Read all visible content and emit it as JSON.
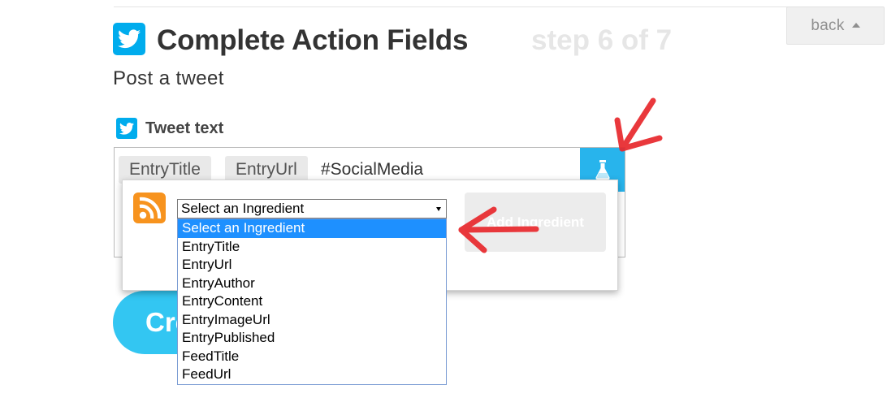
{
  "header": {
    "title": "Complete Action Fields",
    "step": "step 6 of 7",
    "subtitle": "Post a tweet",
    "back_label": "back"
  },
  "field": {
    "label": "Tweet text",
    "tokens": [
      "EntryTitle",
      "EntryUrl"
    ],
    "text": "#SocialMedia"
  },
  "ingredient_picker": {
    "selected": "Select an Ingredient",
    "options": [
      "Select an Ingredient",
      "EntryTitle",
      "EntryUrl",
      "EntryAuthor",
      "EntryContent",
      "EntryImageUrl",
      "EntryPublished",
      "FeedTitle",
      "FeedUrl"
    ],
    "add_label": "Add Ingredient"
  },
  "create_button_label": "Create Action",
  "icons": {
    "service": "twitter-bird-icon",
    "trigger": "rss-feed-icon",
    "ingredients": "flask-icon"
  },
  "colors": {
    "twitter_blue": "#00aced",
    "flask_blue": "#28b4ec",
    "create_blue": "#33c6f2",
    "rss_orange": "#f7931e",
    "highlight": "#1e90ff",
    "annotation_red": "#e8282c"
  }
}
